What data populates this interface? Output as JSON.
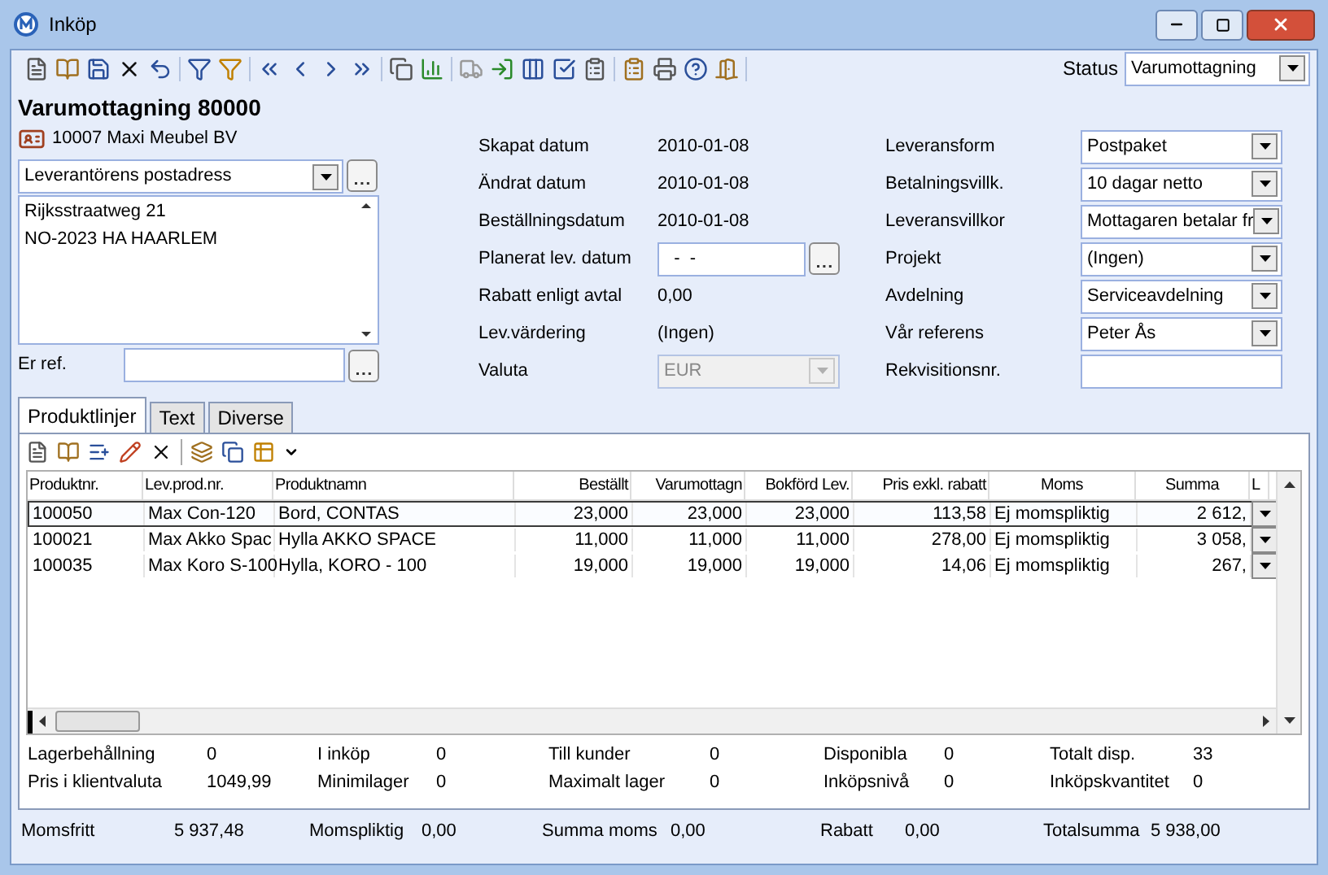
{
  "window": {
    "title": "Inköp"
  },
  "status": {
    "label": "Status",
    "value": "Varumottagning"
  },
  "heading": "Varumottagning 80000",
  "supplier": "10007 Maxi Meubel BV",
  "address": {
    "type": "Leverantörens postadress",
    "lines": [
      "Rijksstraatweg 21",
      "NO-2023 HA HAARLEM"
    ]
  },
  "er_ref": {
    "label": "Er ref."
  },
  "info": [
    {
      "label": "Skapat datum",
      "value": "2010-01-08",
      "kind": "text"
    },
    {
      "label": "Ändrat datum",
      "value": "2010-01-08",
      "kind": "text"
    },
    {
      "label": "Beställningsdatum",
      "value": "2010-01-08",
      "kind": "text"
    },
    {
      "label": "Planerat lev. datum",
      "value": "  -  -",
      "kind": "date"
    },
    {
      "label": "Rabatt enligt avtal",
      "value": "0,00",
      "kind": "text"
    },
    {
      "label": "Lev.värdering",
      "value": "(Ingen)",
      "kind": "text"
    },
    {
      "label": "Valuta",
      "value": "EUR",
      "kind": "select",
      "disabled": true
    }
  ],
  "fields": [
    {
      "label": "Leveransform",
      "value": "Postpaket",
      "kind": "select"
    },
    {
      "label": "Betalningsvillk.",
      "value": "10 dagar netto",
      "kind": "select"
    },
    {
      "label": "Leveransvillkor",
      "value": "Mottagaren betalar fr",
      "kind": "select"
    },
    {
      "label": "Projekt",
      "value": "(Ingen)",
      "kind": "select"
    },
    {
      "label": "Avdelning",
      "value": "Serviceavdelning",
      "kind": "select"
    },
    {
      "label": "Vår referens",
      "value": "Peter Ås",
      "kind": "select"
    },
    {
      "label": "Rekvisitionsnr.",
      "kind": "input"
    }
  ],
  "tabs": [
    {
      "label": "Produktlinjer",
      "selected": true
    },
    {
      "label": "Text",
      "selected": false
    },
    {
      "label": "Diverse",
      "selected": false
    }
  ],
  "table": {
    "columns": [
      "Produktnr.",
      "Lev.prod.nr.",
      "Produktnamn",
      "Beställt",
      "Varumottagn",
      "Bokförd Lev.",
      "Pris exkl. rabatt",
      "Moms",
      "Summa",
      "L"
    ],
    "rows": [
      {
        "selected": true,
        "cells": [
          "100050",
          "Max Con-120",
          "Bord, CONTAS",
          "23,000",
          "23,000",
          "23,000",
          "113,58",
          "Ej momspliktig",
          "2 612,"
        ]
      },
      {
        "selected": false,
        "cells": [
          "100021",
          "Max Akko Spac",
          "Hylla AKKO SPACE",
          "11,000",
          "11,000",
          "11,000",
          "278,00",
          "Ej momspliktig",
          "3 058,"
        ]
      },
      {
        "selected": false,
        "cells": [
          "100035",
          "Max Koro S-100",
          "Hylla, KORO - 100",
          "19,000",
          "19,000",
          "19,000",
          "14,06",
          "Ej momspliktig",
          "267,"
        ]
      }
    ]
  },
  "stats": [
    [
      {
        "label": "Lagerbehållning",
        "value": "0"
      },
      {
        "label": "I inköp",
        "value": "0"
      },
      {
        "label": "Till kunder",
        "value": "0"
      },
      {
        "label": "Disponibla",
        "value": "0"
      },
      {
        "label": "Totalt disp.",
        "value": "33"
      }
    ],
    [
      {
        "label": "Pris i klientvaluta",
        "value": "1049,99"
      },
      {
        "label": "Minimilager",
        "value": "0"
      },
      {
        "label": "Maximalt lager",
        "value": "0"
      },
      {
        "label": "Inköpsnivå",
        "value": "0"
      },
      {
        "label": "Inköpskvantitet",
        "value": "0"
      }
    ]
  ],
  "totals": [
    {
      "label": "Momsfritt",
      "value": "5 937,48"
    },
    {
      "label": "Momspliktig",
      "value": "0,00"
    },
    {
      "label": "Summa moms",
      "value": "0,00"
    },
    {
      "label": "Rabatt",
      "value": "0,00"
    },
    {
      "label": "Totalsumma",
      "value": "5 938,00"
    }
  ]
}
